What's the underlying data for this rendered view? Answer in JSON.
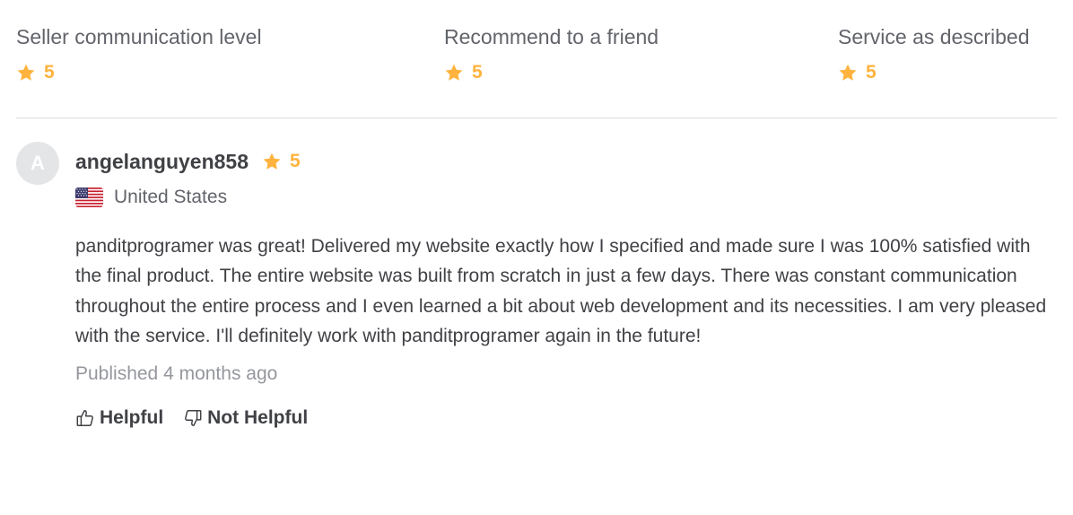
{
  "colors": {
    "star": "#ffb33e",
    "text_primary": "#404145",
    "text_secondary": "#62646a",
    "text_muted": "#95979d",
    "divider": "#dadbdd",
    "avatar_bg": "#e4e5e7"
  },
  "ratings_breakdown": [
    {
      "label": "Seller communication level",
      "value": "5",
      "icon": "star-icon"
    },
    {
      "label": "Recommend to a friend",
      "value": "5",
      "icon": "star-icon"
    },
    {
      "label": "Service as described",
      "value": "5",
      "icon": "star-icon"
    }
  ],
  "review": {
    "avatar_initial": "A",
    "username": "angelanguyen858",
    "rating": "5",
    "country": "United States",
    "flag_icon": "us-flag-icon",
    "text": "panditprogramer was great! Delivered my website exactly how I specified and made sure I was 100% satisfied with the final product. The entire website was built from scratch in just a few days. There was constant communication throughout the entire process and I even learned a bit about web development and its necessities. I am very pleased with the service. I'll definitely work with panditprogramer again in the future!",
    "published": "Published 4 months ago",
    "helpful_label": "Helpful",
    "not_helpful_label": "Not Helpful"
  }
}
